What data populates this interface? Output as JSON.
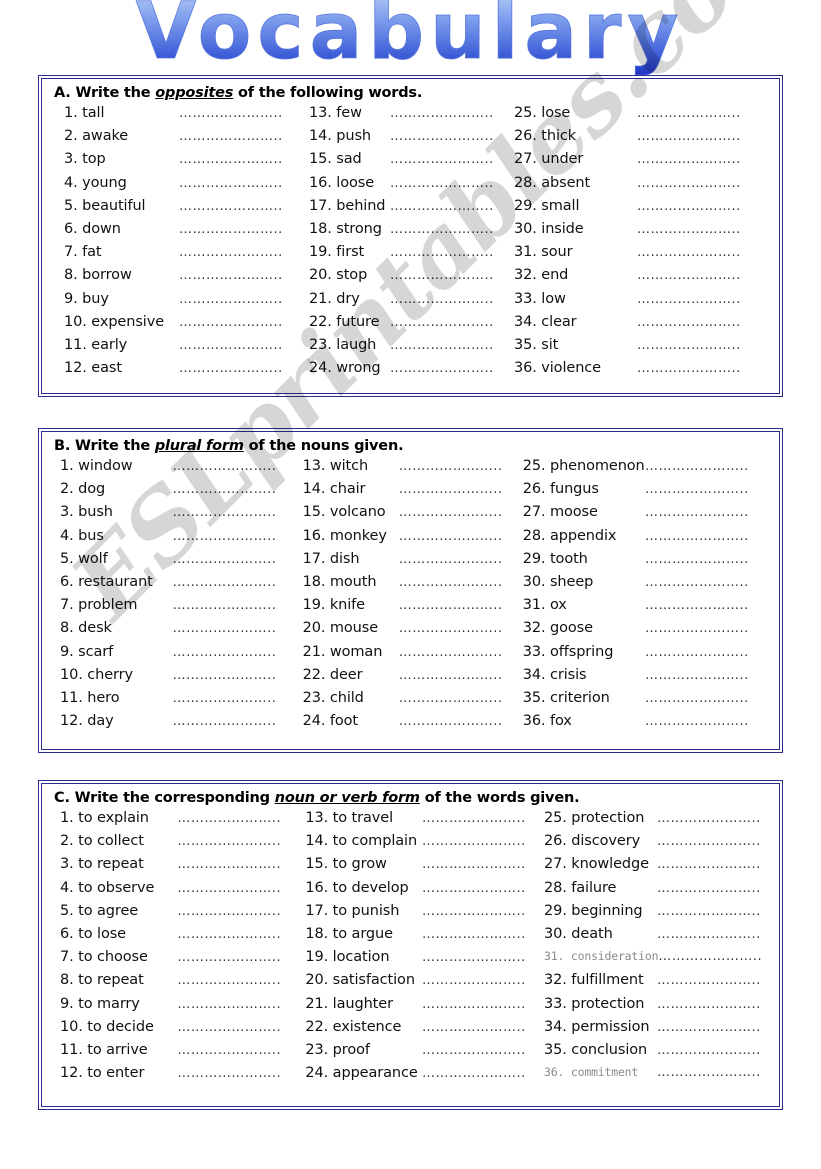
{
  "page": {
    "title": "Vocabulary",
    "title_colors": {
      "top": "#a8c3f0",
      "mid": "#6f93e8",
      "bottom": "#2036c8"
    },
    "border_color": "#2b2b8f",
    "watermark": "ESLprintables.com",
    "blank_line": "………………….."
  },
  "sections": [
    {
      "id": "A",
      "heading_prefix": "A. Write the ",
      "heading_emphasis": "opposites",
      "heading_suffix": " of the following words.",
      "columns": [
        {
          "items": [
            {
              "n": "1.",
              "word": "tall"
            },
            {
              "n": "2.",
              "word": "awake"
            },
            {
              "n": "3.",
              "word": "top"
            },
            {
              "n": "4.",
              "word": "young"
            },
            {
              "n": "5.",
              "word": "beautiful"
            },
            {
              "n": "6.",
              "word": "down"
            },
            {
              "n": "7.",
              "word": "fat"
            },
            {
              "n": "8.",
              "word": "borrow"
            },
            {
              "n": "9.",
              "word": "buy"
            },
            {
              "n": "10.",
              "word": "expensive"
            },
            {
              "n": "11.",
              "word": "early"
            },
            {
              "n": "12.",
              "word": "east"
            }
          ]
        },
        {
          "items": [
            {
              "n": "13.",
              "word": "few"
            },
            {
              "n": "14.",
              "word": "push"
            },
            {
              "n": "15.",
              "word": "sad"
            },
            {
              "n": "16.",
              "word": "loose"
            },
            {
              "n": "17.",
              "word": "behind"
            },
            {
              "n": "18.",
              "word": "strong"
            },
            {
              "n": "19.",
              "word": "first"
            },
            {
              "n": "20.",
              "word": "stop"
            },
            {
              "n": "21.",
              "word": "dry"
            },
            {
              "n": "22.",
              "word": "future"
            },
            {
              "n": "23.",
              "word": "laugh"
            },
            {
              "n": "24.",
              "word": "wrong"
            }
          ]
        },
        {
          "items": [
            {
              "n": "25.",
              "word": "lose"
            },
            {
              "n": "26.",
              "word": "thick"
            },
            {
              "n": "27.",
              "word": "under"
            },
            {
              "n": "28.",
              "word": "absent"
            },
            {
              "n": "29.",
              "word": "small"
            },
            {
              "n": "30.",
              "word": "inside"
            },
            {
              "n": "31.",
              "word": "sour"
            },
            {
              "n": "32.",
              "word": "end"
            },
            {
              "n": "33.",
              "word": "low"
            },
            {
              "n": "34.",
              "word": "clear"
            },
            {
              "n": "35.",
              "word": "sit"
            },
            {
              "n": "36.",
              "word": "violence"
            }
          ]
        }
      ]
    },
    {
      "id": "B",
      "heading_prefix": "B. Write the ",
      "heading_emphasis": "plural form",
      "heading_suffix": " of the nouns given.",
      "columns": [
        {
          "items": [
            {
              "n": "1.",
              "word": "window"
            },
            {
              "n": "2.",
              "word": "dog"
            },
            {
              "n": "3.",
              "word": "bush"
            },
            {
              "n": "4.",
              "word": "bus"
            },
            {
              "n": "5.",
              "word": "wolf"
            },
            {
              "n": "6.",
              "word": "restaurant"
            },
            {
              "n": "7.",
              "word": "problem"
            },
            {
              "n": "8.",
              "word": "desk"
            },
            {
              "n": "9.",
              "word": "scarf"
            },
            {
              "n": "10.",
              "word": "cherry"
            },
            {
              "n": "11.",
              "word": "hero"
            },
            {
              "n": "12.",
              "word": "day"
            }
          ]
        },
        {
          "items": [
            {
              "n": "13.",
              "word": "witch"
            },
            {
              "n": "14.",
              "word": "chair"
            },
            {
              "n": "15.",
              "word": "volcano"
            },
            {
              "n": "16.",
              "word": "monkey"
            },
            {
              "n": "17.",
              "word": "dish"
            },
            {
              "n": "18.",
              "word": "mouth"
            },
            {
              "n": "19.",
              "word": "knife"
            },
            {
              "n": "20.",
              "word": "mouse"
            },
            {
              "n": "21.",
              "word": "woman"
            },
            {
              "n": "22.",
              "word": "deer"
            },
            {
              "n": "23.",
              "word": "child"
            },
            {
              "n": "24.",
              "word": "foot"
            }
          ]
        },
        {
          "items": [
            {
              "n": "25.",
              "word": "phenomenon"
            },
            {
              "n": "26.",
              "word": "fungus"
            },
            {
              "n": "27.",
              "word": "moose"
            },
            {
              "n": "28.",
              "word": "appendix"
            },
            {
              "n": "29.",
              "word": "tooth"
            },
            {
              "n": "30.",
              "word": "sheep"
            },
            {
              "n": "31.",
              "word": "ox"
            },
            {
              "n": "32.",
              "word": "goose"
            },
            {
              "n": "33.",
              "word": "offspring"
            },
            {
              "n": "34.",
              "word": "crisis"
            },
            {
              "n": "35.",
              "word": "criterion"
            },
            {
              "n": "36.",
              "word": "fox"
            }
          ]
        }
      ]
    },
    {
      "id": "C",
      "heading_prefix": "C. Write the corresponding ",
      "heading_emphasis": "noun or verb form",
      "heading_suffix": " of the words given.",
      "columns": [
        {
          "items": [
            {
              "n": "1.",
              "word": "to explain"
            },
            {
              "n": "2.",
              "word": "to collect"
            },
            {
              "n": "3.",
              "word": "to repeat"
            },
            {
              "n": "4.",
              "word": "to observe"
            },
            {
              "n": "5.",
              "word": "to agree"
            },
            {
              "n": "6.",
              "word": "to lose"
            },
            {
              "n": "7.",
              "word": "to choose"
            },
            {
              "n": "8.",
              "word": "to repeat"
            },
            {
              "n": "9.",
              "word": "to marry"
            },
            {
              "n": "10.",
              "word": "to decide"
            },
            {
              "n": "11.",
              "word": "to arrive"
            },
            {
              "n": "12.",
              "word": "to enter"
            }
          ]
        },
        {
          "items": [
            {
              "n": "13.",
              "word": "to travel"
            },
            {
              "n": "14.",
              "word": "to complain"
            },
            {
              "n": "15.",
              "word": "to grow"
            },
            {
              "n": "16.",
              "word": "to develop"
            },
            {
              "n": "17.",
              "word": "to punish"
            },
            {
              "n": "18.",
              "word": "to argue"
            },
            {
              "n": "19.",
              "word": "location"
            },
            {
              "n": "20.",
              "word": "satisfaction"
            },
            {
              "n": "21.",
              "word": "laughter"
            },
            {
              "n": "22.",
              "word": "existence"
            },
            {
              "n": "23.",
              "word": "proof"
            },
            {
              "n": "24.",
              "word": "appearance"
            }
          ]
        },
        {
          "items": [
            {
              "n": "25.",
              "word": "protection"
            },
            {
              "n": "26.",
              "word": "discovery"
            },
            {
              "n": "27.",
              "word": "knowledge"
            },
            {
              "n": "28.",
              "word": "failure"
            },
            {
              "n": "29.",
              "word": "beginning"
            },
            {
              "n": "30.",
              "word": "death"
            },
            {
              "n": "31.",
              "word": "consideration",
              "style": "alt"
            },
            {
              "n": "32.",
              "word": "fulfillment"
            },
            {
              "n": "33.",
              "word": "protection"
            },
            {
              "n": "34.",
              "word": "permission"
            },
            {
              "n": "35.",
              "word": "conclusion"
            },
            {
              "n": "36.",
              "word": "commitment",
              "style": "alt"
            }
          ]
        }
      ]
    }
  ]
}
